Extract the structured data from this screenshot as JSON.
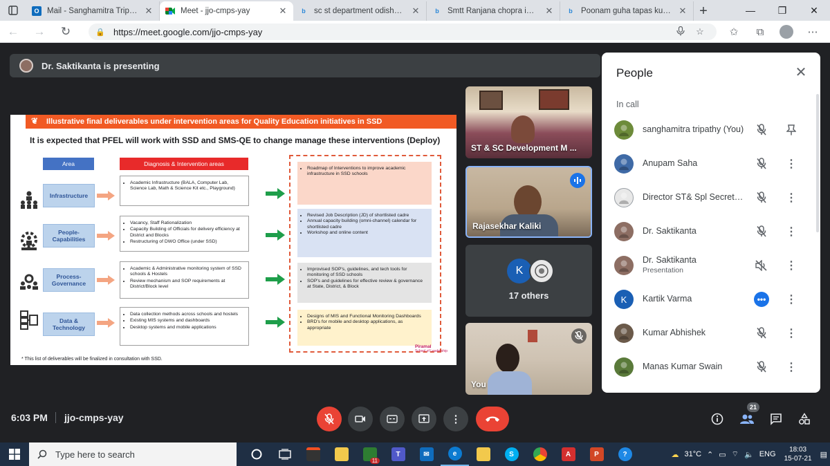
{
  "browser": {
    "tabs": [
      {
        "label": "Mail - Sanghamitra Tripathy -",
        "icon": "outlook-icon",
        "active": false
      },
      {
        "label": "Meet - jjo-cmps-yay",
        "icon": "meet-icon",
        "active": true
      },
      {
        "label": "sc st department odisha Princ",
        "icon": "bing-icon",
        "active": false
      },
      {
        "label": "Smtt Ranjana chopra images",
        "icon": "bing-icon",
        "active": false
      },
      {
        "label": "Poonam guha tapas kumar in",
        "icon": "bing-icon",
        "active": false
      }
    ],
    "url": "https://meet.google.com/jjo-cmps-yay"
  },
  "meet": {
    "presenting_label": "Dr. Saktikanta is presenting",
    "slide": {
      "banner": "Illustrative final deliverables under intervention areas for Quality Education initiatives in SSD",
      "subtitle": "It is expected that PFEL will work with SSD and SMS-QE to change manage these interventions (Deploy)",
      "col_area": "Area",
      "col_diag": "Diagnosis & Intervention areas",
      "rows": [
        {
          "area": "Infrastructure",
          "diag": [
            "Academic Infrastructure (BALA, Computer Lab, Science Lab, Math & Science Kit etc., Playground)"
          ],
          "deploy": [
            "Roadmap of Interventions to improve academic infrastructure in SSD schools"
          ]
        },
        {
          "area": "People-Capabilities",
          "diag": [
            "Vacancy, Staff Rationalization",
            "Capacity Building of Officials for delivery efficiency at District and Blocks",
            "Restructuring of DWO Office (under SSD)"
          ],
          "deploy": [
            "Revised Job Description (JD) of shortlisted cadre",
            "Annual capacity building (omni-channel) calendar for shortlisted cadre",
            "Workshop and online content"
          ]
        },
        {
          "area": "Process-Governance",
          "diag": [
            "Academic & Administrative monitoring system of SSD schools & Hostels",
            "Review mechanism and SOP requirements at District/Block level"
          ],
          "deploy": [
            "Improvised SOP's, guidelines, and tech tools for monitoring of SSD schools",
            "SOP's and guidelines for effective review & governance at State, District, & Block"
          ]
        },
        {
          "area": "Data & Technology",
          "diag": [
            "Data collection methods across schools and hostels",
            "Existing MIS systems and dashboards",
            "Desktop systems and mobile applications"
          ],
          "deploy": [
            "Designs of MIS and Functional Monitoring Dashboards",
            "BRD's for mobile and desktop applications, as appropriate"
          ]
        }
      ],
      "footnote": "* This list of deliverables will be finalized in consultation with SSD.",
      "brand": "Piramal",
      "brand_sub": "School of Leadership"
    },
    "tiles": [
      {
        "name": "ST & SC Development M ..."
      },
      {
        "name": "Rajasekhar Kaliki"
      },
      {
        "name": "17 others",
        "avatar_letter": "K"
      },
      {
        "name": "You"
      }
    ],
    "panel": {
      "title": "People",
      "section": "In call",
      "people": [
        {
          "name": "sanghamitra tripathy (You)",
          "sub": "",
          "avatar": "",
          "color": "#6d8b3a"
        },
        {
          "name": "Anupam Saha",
          "sub": "",
          "avatar": "",
          "color": "#3f6aa6"
        },
        {
          "name": "Director ST& Spl Secretar...",
          "sub": "",
          "avatar": "",
          "color": "#e8e8e8"
        },
        {
          "name": "Dr. Saktikanta",
          "sub": "",
          "avatar": "",
          "color": "#8d6e63"
        },
        {
          "name": "Dr. Saktikanta",
          "sub": "Presentation",
          "avatar": "",
          "color": "#8d6e63"
        },
        {
          "name": "Kartik Varma",
          "sub": "",
          "avatar": "K",
          "color": "#1a5fb4"
        },
        {
          "name": "Kumar Abhishek",
          "sub": "",
          "avatar": "",
          "color": "#6b5a4a"
        },
        {
          "name": "Manas Kumar Swain",
          "sub": "",
          "avatar": "",
          "color": "#5a7a3a"
        }
      ]
    },
    "bar": {
      "time": "6:03 PM",
      "code": "jjo-cmps-yay",
      "participant_count": "21"
    }
  },
  "taskbar": {
    "search_placeholder": "Type here to search",
    "temperature": "31°C",
    "lang": "ENG",
    "time": "18:03",
    "date": "15-07-21",
    "mail_badge": "11"
  }
}
